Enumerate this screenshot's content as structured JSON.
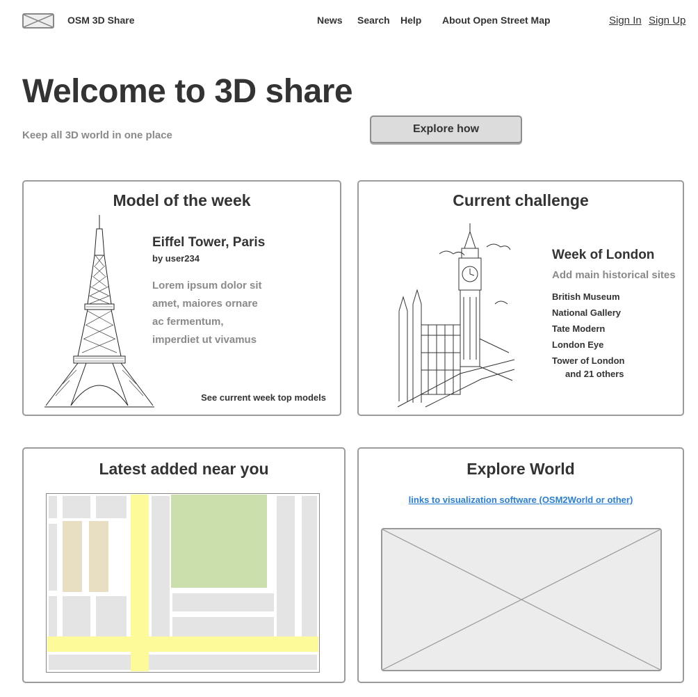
{
  "header": {
    "brand": "OSM 3D Share",
    "logo_icon": "image-placeholder-icon",
    "nav": [
      "News",
      "Search",
      "Help",
      "About Open Street Map"
    ],
    "sign_in": "Sign In",
    "sign_up": "Sign Up"
  },
  "hero": {
    "title": "Welcome to 3D share",
    "subtitle": "Keep all 3D world in one place",
    "button": "Explore how"
  },
  "model_of_week": {
    "title": "Model of the week",
    "image_icon": "eiffel-tower-icon",
    "name": "Eiffel Tower, Paris",
    "author": "by user234",
    "description": "Lorem ipsum dolor sit amet, maiores ornare ac fermentum, imperdiet ut vivamus",
    "link": "See current week top models"
  },
  "current_challenge": {
    "title": "Current challenge",
    "image_icon": "big-ben-icon",
    "challenge_title": "Week of London",
    "challenge_subtitle": "Add main historical sites",
    "sites": [
      "British Museum",
      "National Gallery",
      "Tate Modern",
      "London Eye",
      "Tower of London"
    ],
    "more": "and 21 others"
  },
  "latest_near": {
    "title": "Latest added near you",
    "map_icon": "map-icon"
  },
  "explore_world": {
    "title": "Explore World",
    "link": "links to visualization software (OSM2World or other)",
    "placeholder_icon": "image-placeholder-icon"
  },
  "colors": {
    "text": "#333333",
    "muted": "#8a8a8a",
    "link": "#2a7fd4",
    "border": "#9b9b9b",
    "map_road": "#fdfb99",
    "map_park": "#cbdfad",
    "map_building": "#e8dfc3",
    "map_block": "#e4e4e4"
  }
}
